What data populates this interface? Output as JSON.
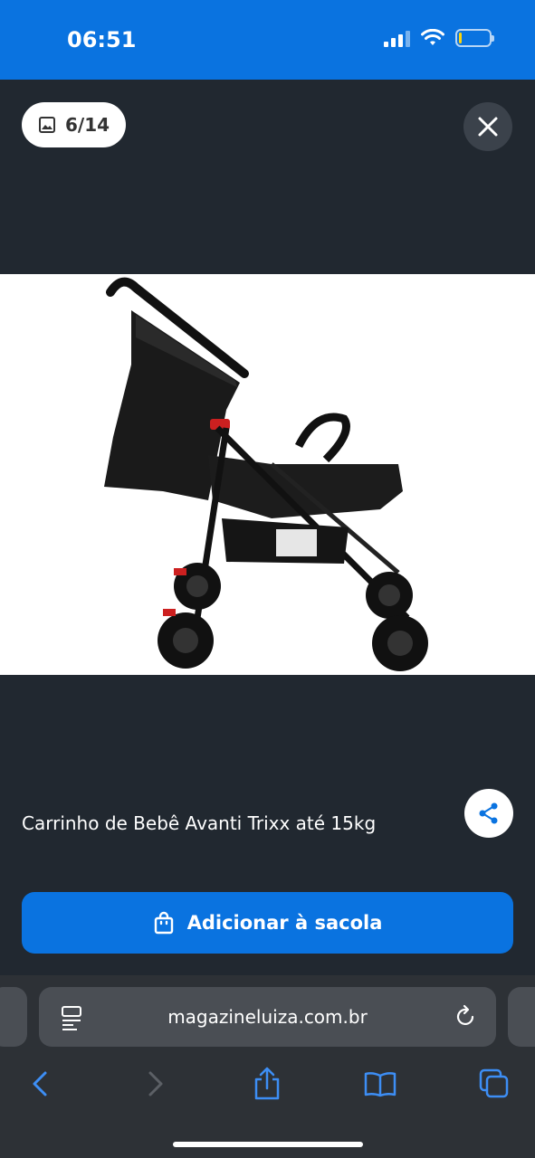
{
  "status_bar": {
    "time": "06:51",
    "icons": [
      "signal-icon",
      "wifi-icon",
      "battery-icon"
    ],
    "battery_level": 0.1
  },
  "gallery": {
    "counter": "6/14",
    "counter_icon": "image-icon",
    "close_icon": "close-icon"
  },
  "product": {
    "title": "Carrinho de Bebê Avanti Trixx até 15kg",
    "share_icon": "share-icon"
  },
  "cta": {
    "label": "Adicionar à sacola",
    "icon": "shopping-bag-icon"
  },
  "browser": {
    "url": "magazineluiza.com.br",
    "toolbar": [
      "back-icon",
      "forward-icon",
      "share-icon",
      "bookmarks-icon",
      "tabs-icon"
    ]
  },
  "colors": {
    "brand_blue": "#0a73e0",
    "background_dark": "#212830"
  }
}
